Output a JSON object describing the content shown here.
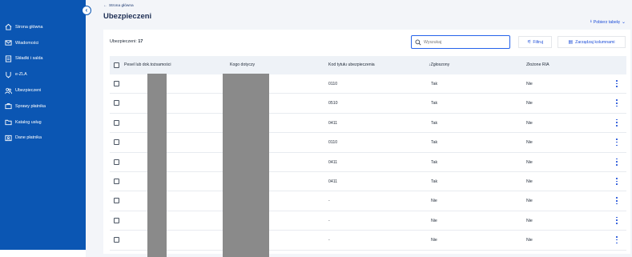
{
  "sidebar": {
    "items": [
      {
        "label": "Strona główna",
        "icon": "home-icon"
      },
      {
        "label": "Wiadomości",
        "icon": "mail-icon"
      },
      {
        "label": "Składki i salda",
        "icon": "receipt-icon"
      },
      {
        "label": "e-ZLA",
        "icon": "medical-icon"
      },
      {
        "label": "Ubezpieczeni",
        "icon": "people-icon"
      },
      {
        "label": "Sprawy płatnika",
        "icon": "briefcase-icon"
      },
      {
        "label": "Katalog usług",
        "icon": "folder-icon"
      },
      {
        "label": "Dane płatnika",
        "icon": "id-card-icon"
      }
    ]
  },
  "header": {
    "back_label": "Strona główna",
    "title": "Ubezpieczeni",
    "download_label": "Pobierz tabelę"
  },
  "toolbar": {
    "count_label": "Ubezpieczeni:",
    "count_value": "17",
    "search_placeholder": "Wyszukaj",
    "filter_label": "Filtruj",
    "columns_label": "Zarządzaj kolumnami"
  },
  "table": {
    "headers": [
      "Pesel lub dok.tożsamości",
      "Kogo dotyczy",
      "Kod tytułu ubezpieczenia",
      "Zgłoszony",
      "Złożone RIA"
    ],
    "sort_indicator": "↓",
    "rows": [
      {
        "kod": "0110",
        "zgloszony": "Tak",
        "ria": "Nie"
      },
      {
        "kod": "0510",
        "zgloszony": "Tak",
        "ria": "Nie"
      },
      {
        "kod": "0411",
        "zgloszony": "Tak",
        "ria": "Nie"
      },
      {
        "kod": "0110",
        "zgloszony": "Tak",
        "ria": "Nie"
      },
      {
        "kod": "0411",
        "zgloszony": "Tak",
        "ria": "Nie"
      },
      {
        "kod": "0411",
        "zgloszony": "Tak",
        "ria": "Nie"
      },
      {
        "kod": "-",
        "zgloszony": "Nie",
        "ria": "Nie"
      },
      {
        "kod": "-",
        "zgloszony": "Nie",
        "ria": "Nie"
      },
      {
        "kod": "-",
        "zgloszony": "Nie",
        "ria": "Nie"
      }
    ]
  },
  "colors": {
    "sidebar_bg": "#0b56b3",
    "accent": "#1d4ed8",
    "page_bg": "#f3f5f9",
    "redaction": "#8a8a8a"
  }
}
